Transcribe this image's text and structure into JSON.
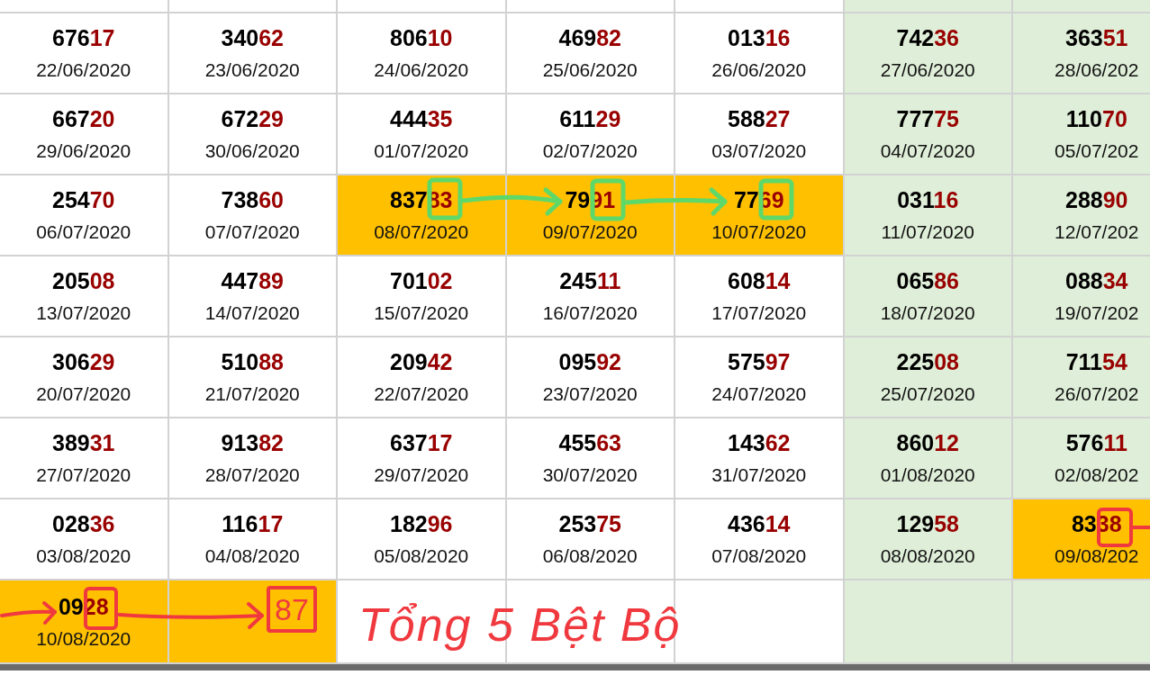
{
  "top_row": [
    {
      "color": "#ffffff"
    },
    {
      "color": "#ffffff"
    },
    {
      "color": "#ffffff"
    },
    {
      "color": "#ffffff"
    },
    {
      "color": "#ffffff"
    },
    {
      "color": "#dfeed8"
    },
    {
      "color": "#dfeed8"
    }
  ],
  "rows": [
    [
      {
        "head": "676",
        "tail": "17",
        "date": "22/06/2020",
        "color": "#ffffff"
      },
      {
        "head": "340",
        "tail": "62",
        "date": "23/06/2020",
        "color": "#ffffff"
      },
      {
        "head": "806",
        "tail": "10",
        "date": "24/06/2020",
        "color": "#ffffff"
      },
      {
        "head": "469",
        "tail": "82",
        "date": "25/06/2020",
        "color": "#ffffff"
      },
      {
        "head": "013",
        "tail": "16",
        "date": "26/06/2020",
        "color": "#ffffff"
      },
      {
        "head": "742",
        "tail": "36",
        "date": "27/06/2020",
        "color": "#dfeed8"
      },
      {
        "head": "363",
        "tail": "51",
        "date": "28/06/202",
        "color": "#dfeed8"
      }
    ],
    [
      {
        "head": "667",
        "tail": "20",
        "date": "29/06/2020",
        "color": "#ffffff"
      },
      {
        "head": "672",
        "tail": "29",
        "date": "30/06/2020",
        "color": "#ffffff"
      },
      {
        "head": "444",
        "tail": "35",
        "date": "01/07/2020",
        "color": "#ffffff"
      },
      {
        "head": "611",
        "tail": "29",
        "date": "02/07/2020",
        "color": "#ffffff"
      },
      {
        "head": "588",
        "tail": "27",
        "date": "03/07/2020",
        "color": "#ffffff"
      },
      {
        "head": "777",
        "tail": "75",
        "date": "04/07/2020",
        "color": "#dfeed8"
      },
      {
        "head": "110",
        "tail": "70",
        "date": "05/07/202",
        "color": "#dfeed8"
      }
    ],
    [
      {
        "head": "254",
        "tail": "70",
        "date": "06/07/2020",
        "color": "#ffffff"
      },
      {
        "head": "738",
        "tail": "60",
        "date": "07/07/2020",
        "color": "#ffffff"
      },
      {
        "head": "837",
        "tail": "83",
        "date": "08/07/2020",
        "color": "#ffc000"
      },
      {
        "head": "79",
        "tail": "91",
        "date": "09/07/2020",
        "color": "#ffc000"
      },
      {
        "head": "77",
        "tail": "69",
        "date": "10/07/2020",
        "color": "#ffc000"
      },
      {
        "head": "031",
        "tail": "16",
        "date": "11/07/2020",
        "color": "#dfeed8"
      },
      {
        "head": "288",
        "tail": "90",
        "date": "12/07/202",
        "color": "#dfeed8"
      }
    ],
    [
      {
        "head": "205",
        "tail": "08",
        "date": "13/07/2020",
        "color": "#ffffff"
      },
      {
        "head": "447",
        "tail": "89",
        "date": "14/07/2020",
        "color": "#ffffff"
      },
      {
        "head": "701",
        "tail": "02",
        "date": "15/07/2020",
        "color": "#ffffff"
      },
      {
        "head": "245",
        "tail": "11",
        "date": "16/07/2020",
        "color": "#ffffff"
      },
      {
        "head": "608",
        "tail": "14",
        "date": "17/07/2020",
        "color": "#ffffff"
      },
      {
        "head": "065",
        "tail": "86",
        "date": "18/07/2020",
        "color": "#dfeed8"
      },
      {
        "head": "088",
        "tail": "34",
        "date": "19/07/202",
        "color": "#dfeed8"
      }
    ],
    [
      {
        "head": "306",
        "tail": "29",
        "date": "20/07/2020",
        "color": "#ffffff"
      },
      {
        "head": "510",
        "tail": "88",
        "date": "21/07/2020",
        "color": "#ffffff"
      },
      {
        "head": "209",
        "tail": "42",
        "date": "22/07/2020",
        "color": "#ffffff"
      },
      {
        "head": "095",
        "tail": "92",
        "date": "23/07/2020",
        "color": "#ffffff"
      },
      {
        "head": "575",
        "tail": "97",
        "date": "24/07/2020",
        "color": "#ffffff"
      },
      {
        "head": "225",
        "tail": "08",
        "date": "25/07/2020",
        "color": "#dfeed8"
      },
      {
        "head": "711",
        "tail": "54",
        "date": "26/07/202",
        "color": "#dfeed8"
      }
    ],
    [
      {
        "head": "389",
        "tail": "31",
        "date": "27/07/2020",
        "color": "#ffffff"
      },
      {
        "head": "913",
        "tail": "82",
        "date": "28/07/2020",
        "color": "#ffffff"
      },
      {
        "head": "637",
        "tail": "17",
        "date": "29/07/2020",
        "color": "#ffffff"
      },
      {
        "head": "455",
        "tail": "63",
        "date": "30/07/2020",
        "color": "#ffffff"
      },
      {
        "head": "143",
        "tail": "62",
        "date": "31/07/2020",
        "color": "#ffffff"
      },
      {
        "head": "860",
        "tail": "12",
        "date": "01/08/2020",
        "color": "#dfeed8"
      },
      {
        "head": "576",
        "tail": "11",
        "date": "02/08/202",
        "color": "#dfeed8"
      }
    ],
    [
      {
        "head": "028",
        "tail": "36",
        "date": "03/08/2020",
        "color": "#ffffff"
      },
      {
        "head": "116",
        "tail": "17",
        "date": "04/08/2020",
        "color": "#ffffff"
      },
      {
        "head": "182",
        "tail": "96",
        "date": "05/08/2020",
        "color": "#ffffff"
      },
      {
        "head": "253",
        "tail": "75",
        "date": "06/08/2020",
        "color": "#ffffff"
      },
      {
        "head": "436",
        "tail": "14",
        "date": "07/08/2020",
        "color": "#ffffff"
      },
      {
        "head": "129",
        "tail": "58",
        "date": "08/08/2020",
        "color": "#dfeed8"
      },
      {
        "head": "83",
        "tail": "38",
        "date": "09/08/202",
        "color": "#ffc000"
      }
    ],
    [
      {
        "head": "09",
        "tail": "28",
        "date": "10/08/2020",
        "color": "#ffc000"
      },
      {
        "color": "#ffc000"
      },
      {
        "color": "#ffffff"
      },
      {
        "color": "#ffffff"
      },
      {
        "color": "#ffffff"
      },
      {
        "color": "#dfeed8"
      },
      {
        "color": "#dfeed8"
      }
    ]
  ],
  "annotations": {
    "number": "87",
    "note": "Tổng 5 Bệt Bộ"
  }
}
